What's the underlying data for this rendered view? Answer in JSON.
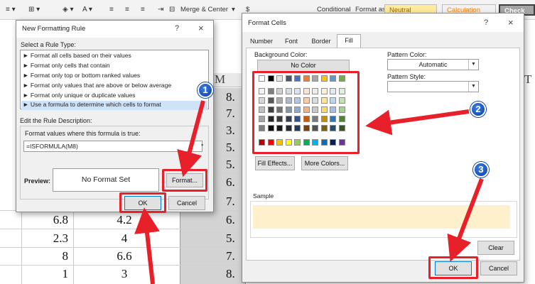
{
  "ribbon": {
    "merge_center": "Merge & Center",
    "conditional": "Conditional",
    "format_as": "Format as",
    "neutral": "Neutral",
    "calculation": "Calculation",
    "check_cell": "Check Cell",
    "dollar": "$"
  },
  "sheet": {
    "col_m_label": "M",
    "col_t_label": "T",
    "col_m_values": [
      "8.",
      "7.",
      "3.",
      "5.",
      "5.",
      "6.",
      "7.",
      "6.",
      "5.",
      "7.",
      "8."
    ],
    "left_values": [
      "6.8",
      "2.3",
      "8",
      "1"
    ],
    "mid_values": [
      "4.2",
      "4",
      "6.6",
      "3"
    ]
  },
  "nfr": {
    "title": "New Formatting Rule",
    "help": "?",
    "close": "×",
    "select_type_label": "Select a Rule Type:",
    "rule_types": [
      "Format all cells based on their values",
      "Format only cells that contain",
      "Format only top or bottom ranked values",
      "Format only values that are above or below average",
      "Format only unique or duplicate values",
      "Use a formula to determine which cells to format"
    ],
    "edit_desc_label": "Edit the Rule Description:",
    "formula_label": "Format values where this formula is true:",
    "formula_value": "=ISFORMULA(M8)",
    "preview_label": "Preview:",
    "preview_text": "No Format Set",
    "format_btn": "Format...",
    "ok_btn": "OK",
    "cancel_btn": "Cancel",
    "arrow_glyph": "►"
  },
  "fc": {
    "title": "Format Cells",
    "help": "?",
    "close": "×",
    "tabs": [
      "Number",
      "Font",
      "Border",
      "Fill"
    ],
    "active_tab": "Fill",
    "bg_color_label": "Background Color:",
    "no_color": "No Color",
    "pattern_color_label": "Pattern Color:",
    "pattern_color_value": "Automatic",
    "pattern_style_label": "Pattern Style:",
    "fill_effects_btn": "Fill Effects...",
    "more_colors_btn": "More Colors...",
    "sample_label": "Sample",
    "sample_color": "#fdf0cb",
    "clear_btn": "Clear",
    "ok_btn": "OK",
    "cancel_btn": "Cancel",
    "theme_row": [
      "#ffffff",
      "#000000",
      "#e7e6e6",
      "#44546a",
      "#4472c4",
      "#ed7d31",
      "#a5a5a5",
      "#ffc000",
      "#5b9bd5",
      "#70ad47"
    ],
    "shade_rows": [
      [
        "#f2f2f2",
        "#7f7f7f",
        "#d0cece",
        "#d6dce4",
        "#d9e2f3",
        "#fbe5d5",
        "#ededed",
        "#fff2cc",
        "#deebf6",
        "#e2efd9"
      ],
      [
        "#d8d8d8",
        "#595959",
        "#aeaaaa",
        "#adb9ca",
        "#b4c6e7",
        "#f7cbac",
        "#dbdbdb",
        "#fee599",
        "#bdd7ee",
        "#c5e0b3"
      ],
      [
        "#bfbfbf",
        "#3f3f3f",
        "#757070",
        "#8496b0",
        "#8eaadb",
        "#f4b183",
        "#c9c9c9",
        "#ffd965",
        "#9cc3e5",
        "#a8d08d"
      ],
      [
        "#a5a5a5",
        "#262626",
        "#3a3838",
        "#323f4f",
        "#2f5496",
        "#c55a11",
        "#7b7b7b",
        "#bf9000",
        "#2e75b5",
        "#538135"
      ],
      [
        "#7f7f7f",
        "#0c0c0c",
        "#171616",
        "#222a35",
        "#1f3864",
        "#833c0b",
        "#525252",
        "#7f6000",
        "#1e4e79",
        "#375623"
      ]
    ],
    "standard_row": [
      "#c00000",
      "#ff0000",
      "#ffc000",
      "#ffff00",
      "#92d050",
      "#00b050",
      "#00b0f0",
      "#0070c0",
      "#002060",
      "#7030a0"
    ]
  },
  "callouts": [
    "1",
    "2",
    "3"
  ],
  "colors": {
    "highlight_red": "#e8202a",
    "badge_blue": "#1a56c4"
  }
}
